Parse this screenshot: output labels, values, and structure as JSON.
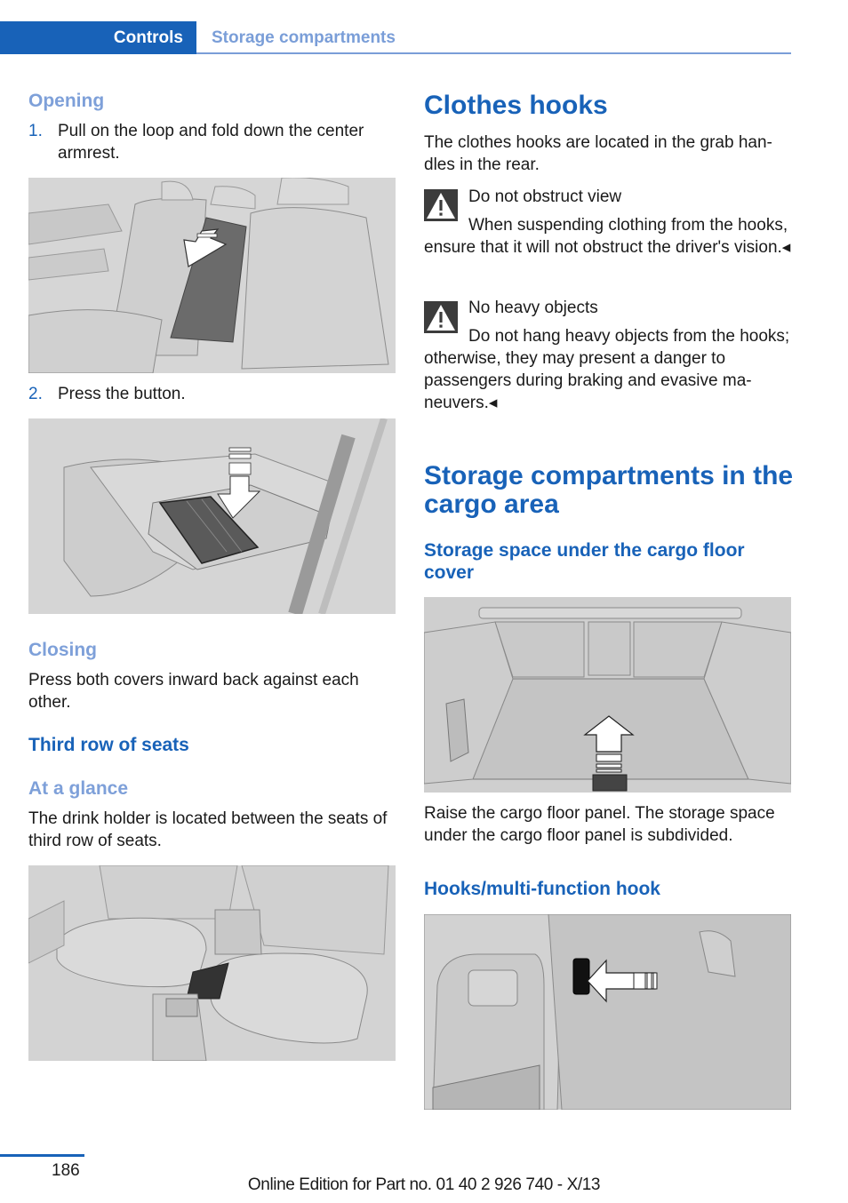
{
  "header": {
    "chapter": "Controls",
    "section": "Storage compartments"
  },
  "left": {
    "opening": {
      "title": "Opening",
      "steps": [
        {
          "num": "1.",
          "text": "Pull on the loop and fold down the center armrest."
        },
        {
          "num": "2.",
          "text": "Press the button."
        }
      ]
    },
    "closing": {
      "title": "Closing",
      "text": "Press both covers inward back against each other."
    },
    "third_row": {
      "title": "Third row of seats",
      "glance_title": "At a glance",
      "text": "The drink holder is located between the seats of third row of seats."
    }
  },
  "right": {
    "clothes_hooks": {
      "title": "Clothes hooks",
      "intro": "The clothes hooks are located in the grab han­dles in the rear.",
      "warnings": [
        {
          "icon": "warning-triangle-icon",
          "title": "Do not obstruct view",
          "text": "When suspending clothing from the hooks, ensure that it will not obstruct the driv­er's vision.◂"
        },
        {
          "icon": "warning-triangle-icon",
          "title": "No heavy objects",
          "text": "Do not hang heavy objects from the hooks; otherwise, they may present a danger to passengers during braking and evasive ma­neuvers.◂"
        }
      ]
    },
    "cargo": {
      "title": "Storage compartments in the cargo area",
      "floor_title": "Storage space under the cargo floor cover",
      "floor_text": "Raise the cargo floor panel. The storage space under the cargo floor panel is subdivided.",
      "hooks_title": "Hooks/multi-function hook"
    }
  },
  "footer": {
    "page_number": "186",
    "edition": "Online Edition for Part no. 01 40 2 926 740 - X/13"
  },
  "colors": {
    "brand_blue": "#1862b8",
    "light_blue": "#7ea0d9",
    "warning_bg": "#3c3c3c"
  }
}
